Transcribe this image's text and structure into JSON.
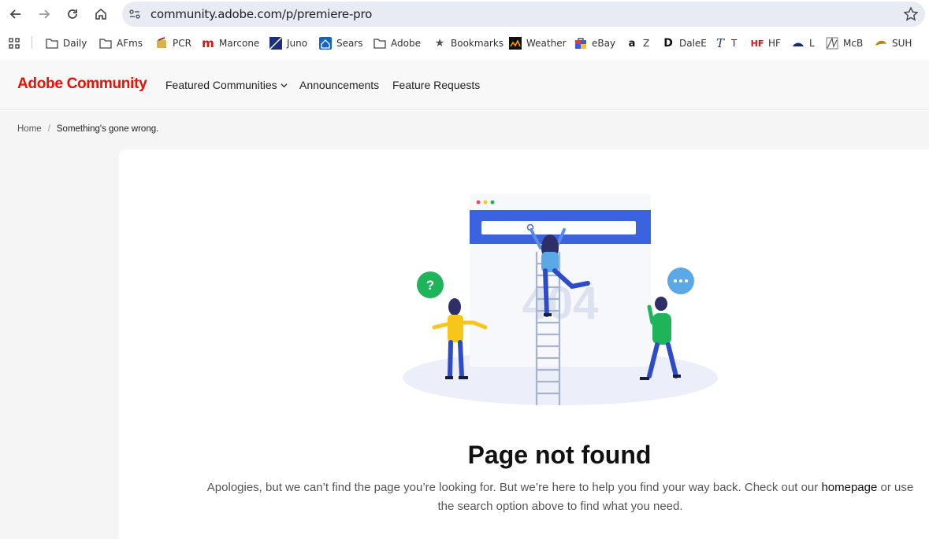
{
  "browser": {
    "url": "community.adobe.com/p/premiere-pro",
    "bookmarks": [
      {
        "label": "Daily",
        "icon": "folder-icon"
      },
      {
        "label": "AFms",
        "icon": "folder-icon"
      },
      {
        "label": "PCR",
        "icon": "pcr-icon"
      },
      {
        "label": "Marcone",
        "icon": "marcone-icon"
      },
      {
        "label": "Juno",
        "icon": "juno-icon"
      },
      {
        "label": "Sears",
        "icon": "sears-icon"
      },
      {
        "label": "Adobe",
        "icon": "folder-icon"
      },
      {
        "label": "Bookmarks",
        "icon": "star-icon"
      },
      {
        "label": "Weather",
        "icon": "weather-icon"
      },
      {
        "label": "eBay",
        "icon": "ebay-icon"
      },
      {
        "label": "Z",
        "icon": "amazon-icon"
      },
      {
        "label": "DaleE",
        "icon": "d-icon"
      },
      {
        "label": "T",
        "icon": "t-icon"
      },
      {
        "label": "HF",
        "icon": "hf-icon"
      },
      {
        "label": "L",
        "icon": "l-icon"
      },
      {
        "label": "McB",
        "icon": "mcb-icon"
      },
      {
        "label": "SUH",
        "icon": "suh-icon"
      }
    ]
  },
  "header": {
    "brand": "Adobe Community",
    "nav": {
      "featured": "Featured Communities",
      "announcements": "Announcements",
      "feature_requests": "Feature Requests"
    }
  },
  "breadcrumb": {
    "home": "Home",
    "separator": "/",
    "current": "Something's gone wrong."
  },
  "error": {
    "illustration_text": "404",
    "title": "Page not found",
    "desc_before": "Apologies, but we can’t find the page you’re looking for. But we’re here to help you find your way back. Check out our ",
    "link": "homepage",
    "desc_after": " or use the search option above to find what you need."
  },
  "colors": {
    "brand": "#eb1000",
    "accent_blue": "#3b63e0",
    "green": "#1fb45a",
    "yellow": "#f8c61a"
  }
}
